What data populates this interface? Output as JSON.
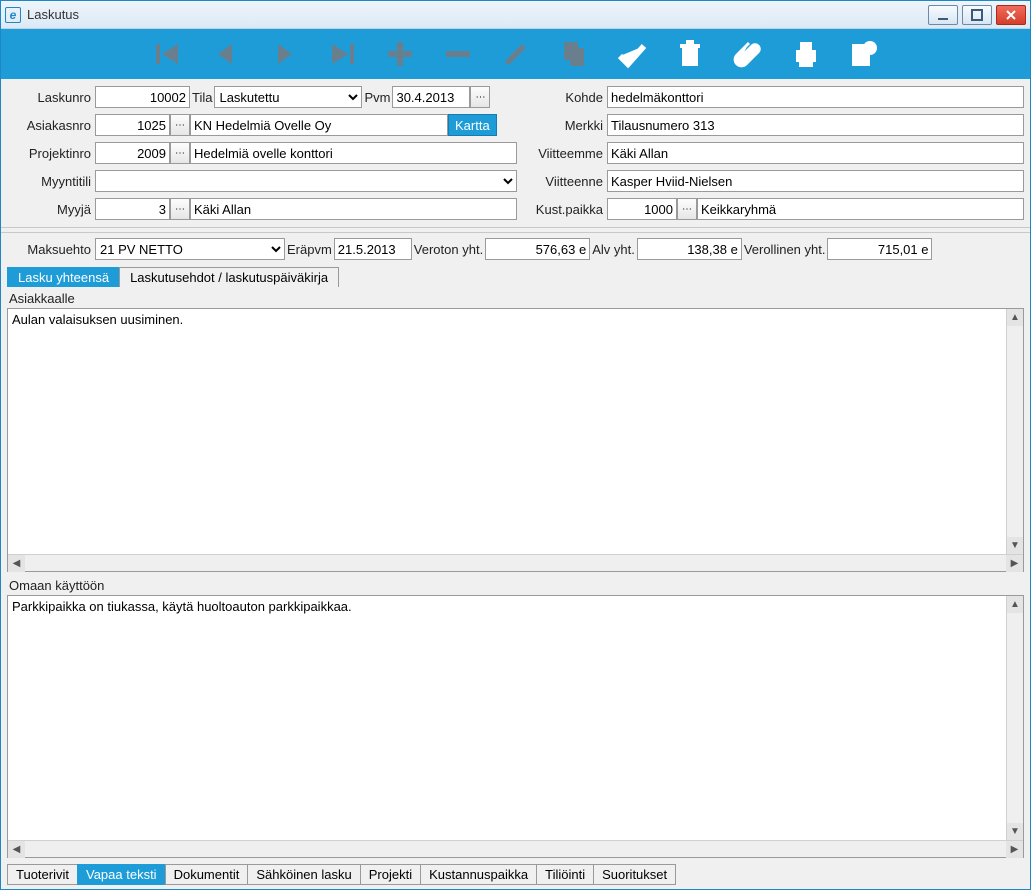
{
  "window": {
    "title": "Laskutus"
  },
  "fields": {
    "laskunro_lbl": "Laskunro",
    "laskunro": "10002",
    "tila_lbl": "Tila",
    "tila": "Laskutettu",
    "pvm_lbl": "Pvm",
    "pvm": "30.4.2013",
    "kohde_lbl": "Kohde",
    "kohde": "hedelmäkonttori",
    "asiakasnro_lbl": "Asiakasnro",
    "asiakasnro": "1025",
    "asiakas_name": "KN Hedelmiä Ovelle Oy",
    "kartta": "Kartta",
    "merkki_lbl": "Merkki",
    "merkki": "Tilausnumero 313",
    "projektinro_lbl": "Projektinro",
    "projektinro": "2009",
    "projekti_name": "Hedelmiä ovelle konttori",
    "viitteemme_lbl": "Viitteemme",
    "viitteemme": "Käki Allan",
    "myyntitili_lbl": "Myyntitili",
    "myyntitili": "",
    "viitteenne_lbl": "Viitteenne",
    "viitteenne": "Kasper Hviid-Nielsen",
    "myyja_lbl": "Myyjä",
    "myyja": "3",
    "myyja_name": "Käki Allan",
    "kustpaikka_lbl": "Kust.paikka",
    "kustpaikka": "1000",
    "kustpaikka_name": "Keikkaryhmä",
    "maksuehto_lbl": "Maksuehto",
    "maksuehto": "21 PV NETTO",
    "erapvm_lbl": "Eräpvm",
    "erapvm": "21.5.2013",
    "veroton_lbl": "Veroton yht.",
    "veroton": "576,63 e",
    "alv_lbl": "Alv yht.",
    "alv": "138,38 e",
    "verollinen_lbl": "Verollinen yht.",
    "verollinen": "715,01 e"
  },
  "subtabs": {
    "t1": "Lasku yhteensä",
    "t2": "Laskutusehdot / laskutuspäiväkirja"
  },
  "sections": {
    "asiakkaalle_lbl": "Asiakkaalle",
    "asiakkaalle_text": "Aulan valaisuksen uusiminen.",
    "omaan_lbl": "Omaan käyttöön",
    "omaan_text": "Parkkipaikka on tiukassa, käytä huoltoauton parkkipaikkaa."
  },
  "bottomtabs": {
    "t1": "Tuoterivit",
    "t2": "Vapaa teksti",
    "t3": "Dokumentit",
    "t4": "Sähköinen lasku",
    "t5": "Projekti",
    "t6": "Kustannuspaikka",
    "t7": "Tiliöinti",
    "t8": "Suoritukset"
  }
}
